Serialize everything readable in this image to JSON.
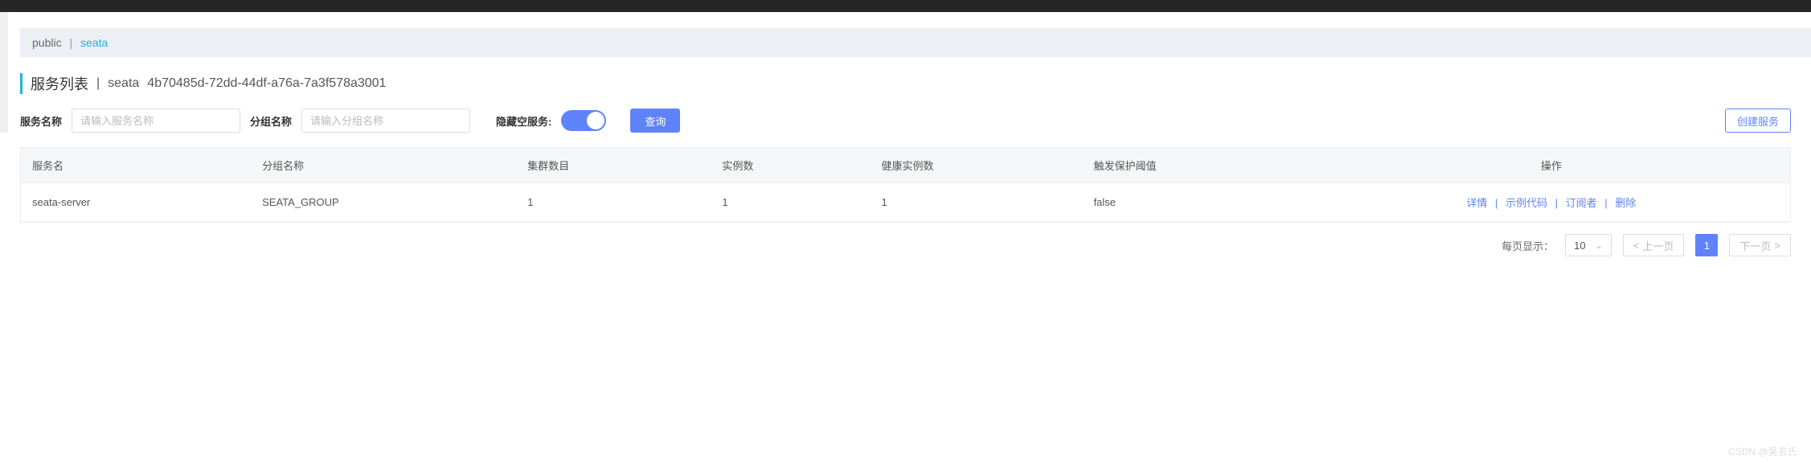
{
  "namespaces": {
    "public": "public",
    "active": "seata"
  },
  "title": {
    "main": "服务列表",
    "ns": "seata",
    "ns_id": "4b70485d-72dd-44df-a76a-7a3f578a3001"
  },
  "filters": {
    "service_name_label": "服务名称",
    "service_name_placeholder": "请输入服务名称",
    "group_name_label": "分组名称",
    "group_name_placeholder": "请输入分组名称",
    "hide_empty_label": "隐藏空服务:",
    "hide_empty_on": true,
    "query_label": "查询"
  },
  "create_label": "创建服务",
  "columns": {
    "name": "服务名",
    "group": "分组名称",
    "cluster_count": "集群数目",
    "instance_count": "实例数",
    "healthy_count": "健康实例数",
    "threshold": "触发保护阈值",
    "ops": "操作"
  },
  "rows": [
    {
      "name": "seata-server",
      "group": "SEATA_GROUP",
      "cluster_count": "1",
      "instance_count": "1",
      "healthy_count": "1",
      "threshold": "false"
    }
  ],
  "ops": {
    "detail": "详情",
    "sample": "示例代码",
    "subscriber": "订阅者",
    "delete": "删除"
  },
  "pager": {
    "per_page_label": "每页显示：",
    "per_page": "10",
    "prev": "上一页",
    "next": "下一页",
    "current": "1"
  },
  "watermark": "CSDN @吴名氏."
}
